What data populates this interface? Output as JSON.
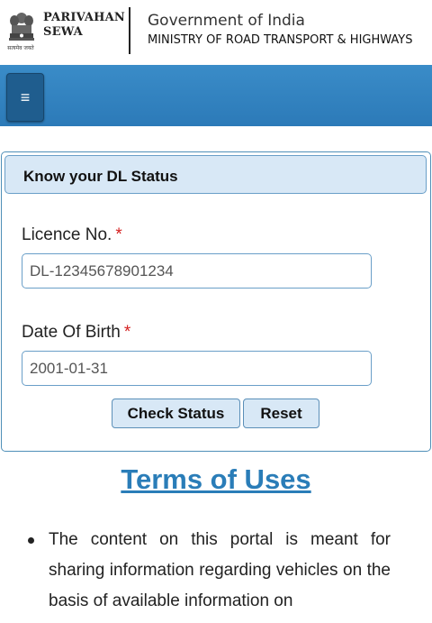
{
  "header": {
    "emblem_caption": "सत्यमेव जयते",
    "brand_line1": "PARIVAHAN",
    "brand_line2": "SEWA",
    "gov_title": "Government of India",
    "ministry": "MINISTRY OF ROAD TRANSPORT & HIGHWAYS"
  },
  "navbar": {
    "menu_icon": "hamburger-icon",
    "menu_glyph": "≡"
  },
  "form": {
    "title": "Know your DL Status",
    "licence_label": "Licence No.",
    "licence_required": "*",
    "licence_value": "DL-12345678901234",
    "dob_label": "Date Of Birth",
    "dob_required": "*",
    "dob_value": "2001-01-31",
    "check_button": "Check Status",
    "reset_button": "Reset"
  },
  "terms": {
    "heading": "Terms of Uses",
    "bullet_text": "The content on this portal is meant for sharing information regarding vehicles on the basis of available information on"
  },
  "colors": {
    "accent": "#2a7db8",
    "navbar": "#3a8cc8",
    "menu_button": "#1f5d8e",
    "required": "#d42020"
  }
}
